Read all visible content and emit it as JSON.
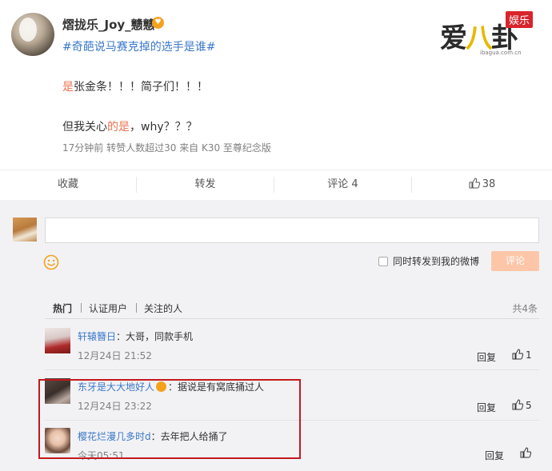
{
  "post": {
    "author": "熠拢乐_Joy_戆戆",
    "topic": "#奇葩说马赛克掉的选手是谁#",
    "line1_prefix": "是",
    "line1_rest": "张金条！！！简子们！！！",
    "line2_prefix": "但我关心",
    "line2_highlight": "的是",
    "line2_rest": "，why？？？",
    "meta": "17分钟前 转赞人数超过30 来自 K30 至尊纪念版"
  },
  "watermark": {
    "main_left": "爱",
    "main_mid": "八",
    "main_right": "卦",
    "tag": "娱乐",
    "url": "ibagua.com.cn"
  },
  "actions": {
    "favorite": "收藏",
    "repost": "转发",
    "comment": "评论 4",
    "like_count": "38"
  },
  "composer": {
    "placeholder": "",
    "repost_option": "同时转发到我的微博",
    "submit": "评论"
  },
  "sort": {
    "hot": "热门",
    "verified": "认证用户",
    "following": "关注的人",
    "total": "共4条"
  },
  "comments": [
    {
      "name": "轩辕簪日",
      "text": "：大哥，同款手机",
      "time": "12月24日 21:52",
      "reply": "回复",
      "likes": "1"
    },
    {
      "name": "东牙是大大地好人",
      "text": "：据说是有窝底捅过人",
      "time": "12月24日 23:22",
      "reply": "回复",
      "likes": "5"
    },
    {
      "name": "樱花烂漫几多时d",
      "text": "：去年把人给捅了",
      "time": "今天05:51",
      "reply": "回复",
      "likes": ""
    }
  ],
  "colors": {
    "link": "#3b78c8",
    "accent": "#eb7350",
    "highlight_box": "#c4191d"
  }
}
